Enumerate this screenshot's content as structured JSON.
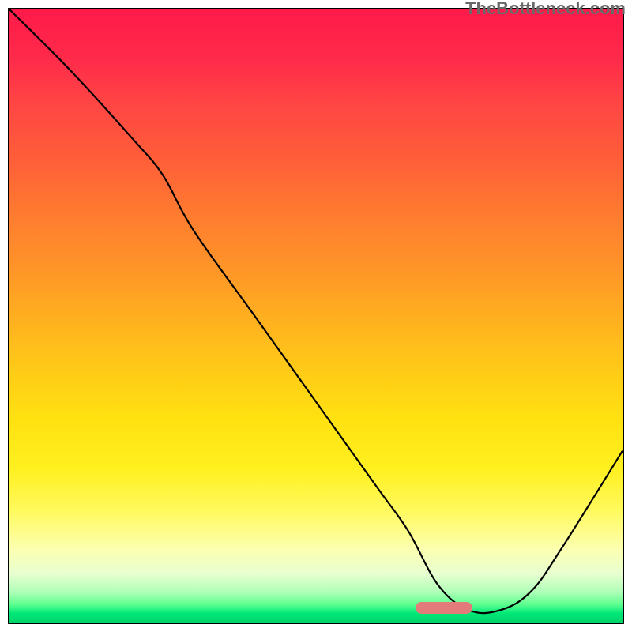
{
  "attribution": "TheBottleneck.com",
  "marker": {
    "left_pct": 70.5,
    "top_pct": 97.0
  },
  "chart_data": {
    "type": "line",
    "title": "",
    "xlabel": "",
    "ylabel": "",
    "xlim": [
      0,
      100
    ],
    "ylim": [
      0,
      100
    ],
    "series": [
      {
        "name": "bottleneck-curve",
        "x": [
          0,
          10,
          20,
          25,
          30,
          40,
          50,
          60,
          65,
          70,
          75,
          80,
          85,
          90,
          100
        ],
        "values": [
          100,
          90,
          79,
          73,
          64,
          50,
          36,
          22,
          15,
          6,
          2,
          2,
          5,
          12,
          28
        ]
      }
    ],
    "background_gradient": {
      "top": "#ff1a4a",
      "mid": "#ffd810",
      "bottom": "#00d46a"
    },
    "marker_band": {
      "x_start": 70,
      "x_end": 79,
      "color": "#e37b7b"
    }
  }
}
